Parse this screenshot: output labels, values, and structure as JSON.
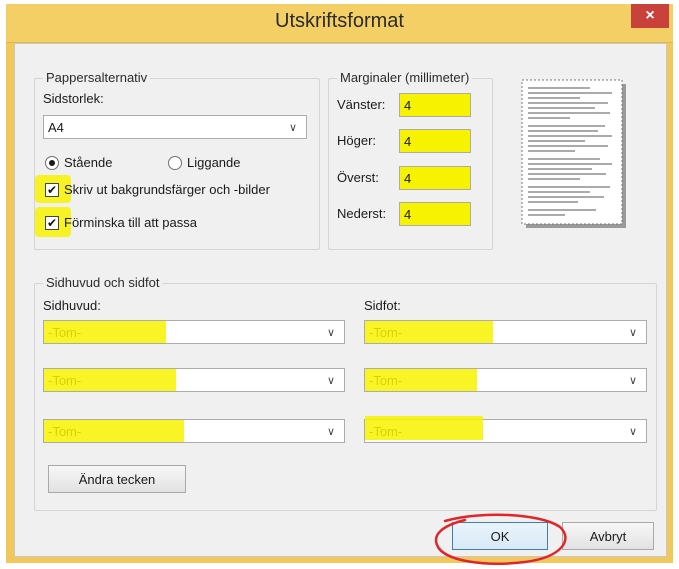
{
  "window": {
    "title": "Utskriftsformat",
    "close_label": "×"
  },
  "paper": {
    "group_title": "Pappersalternativ",
    "size_label": "Sidstorlek:",
    "size_value": "A4",
    "portrait_label": "Stående",
    "landscape_label": "Liggande",
    "orientation_selected": "portrait",
    "bg_label": "Skriv ut bakgrundsfärger och -bilder",
    "bg_checked": true,
    "shrink_label": "Förminska till att passa",
    "shrink_checked": true
  },
  "margins": {
    "group_title": "Marginaler (millimeter)",
    "left_label": "Vänster:",
    "left_value": "4",
    "right_label": "Höger:",
    "right_value": "4",
    "top_label": "Överst:",
    "top_value": "4",
    "bottom_label": "Nederst:",
    "bottom_value": "4"
  },
  "headerfooter": {
    "group_title": "Sidhuvud och sidfot",
    "header_label": "Sidhuvud:",
    "footer_label": "Sidfot:",
    "header_values": [
      "-Tom-",
      "-Tom-",
      "-Tom-"
    ],
    "footer_values": [
      "-Tom-",
      "-Tom-",
      "-Tom-"
    ],
    "font_button": "Ändra tecken"
  },
  "buttons": {
    "ok": "OK",
    "cancel": "Avbryt"
  },
  "colors": {
    "highlight": "#f7f200",
    "annotation_circle": "#e0252b",
    "title_bar": "#f3cf66"
  }
}
